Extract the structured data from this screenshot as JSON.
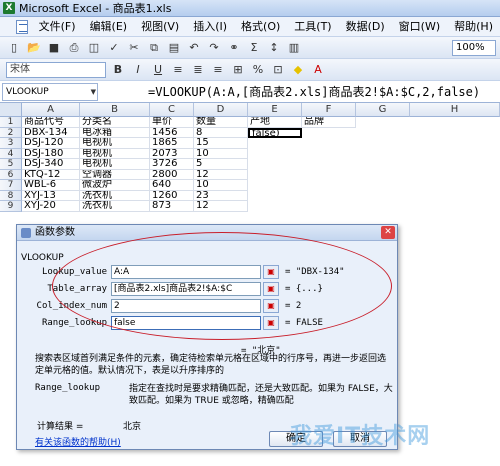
{
  "window": {
    "title": "Microsoft Excel - 商品表1.xls"
  },
  "menu": [
    "文件(F)",
    "编辑(E)",
    "视图(V)",
    "插入(I)",
    "格式(O)",
    "工具(T)",
    "数据(D)",
    "窗口(W)",
    "帮助(H)"
  ],
  "toolbar": {
    "zoom": "100%",
    "font": "宋体"
  },
  "formula_bar": {
    "name_box": "VLOOKUP",
    "formula": "=VLOOKUP(A:A,[商品表2.xls]商品表2!$A:$C,2,false)"
  },
  "columns": [
    "A",
    "B",
    "C",
    "D",
    "E",
    "F",
    "G",
    "H"
  ],
  "rows": [
    [
      "商品代号",
      "分类名",
      "单价",
      "数量",
      "产地",
      "品牌"
    ],
    [
      "DBX-134",
      "电冰箱",
      "1456",
      "8",
      "false)",
      ""
    ],
    [
      "DSJ-120",
      "电视机",
      "1865",
      "15",
      "",
      ""
    ],
    [
      "DSJ-180",
      "电视机",
      "2073",
      "10",
      "",
      ""
    ],
    [
      "DSJ-340",
      "电视机",
      "3726",
      "5",
      "",
      ""
    ],
    [
      "KTQ-12",
      "空调器",
      "2800",
      "12",
      "",
      ""
    ],
    [
      "WBL-6",
      "微波炉",
      "640",
      "10",
      "",
      ""
    ],
    [
      "XYJ-13",
      "洗衣机",
      "1260",
      "23",
      "",
      ""
    ],
    [
      "XYJ-20",
      "洗衣机",
      "873",
      "12",
      "",
      ""
    ]
  ],
  "dialog": {
    "title": "函数参数",
    "function_name": "VLOOKUP",
    "args": [
      {
        "label": "Lookup_value",
        "value": "A:A",
        "result": "= \"DBX-134\""
      },
      {
        "label": "Table_array",
        "value": "[商品表2.xls]商品表2!$A:$C",
        "result": "= {...}"
      },
      {
        "label": "Col_index_num",
        "value": "2",
        "result": "= 2"
      },
      {
        "label": "Range_lookup",
        "value": "false",
        "result": "= FALSE"
      }
    ],
    "formula_result_line": "= \"北京\"",
    "description": "搜索表区域首列满足条件的元素，确定待检索单元格在区域中的行序号，再进一步返回选定单元格的值。默认情况下，表是以升序排序的",
    "arg_help_name": "Range_lookup",
    "arg_help_text": "指定在查找时是要求精确匹配，还是大致匹配。如果为 FALSE，大致匹配。如果为 TRUE 或忽略，精确匹配",
    "calc_label": "计算结果 =",
    "calc_value": "北京",
    "help_link": "有关该函数的帮助(H)",
    "ok": "确定",
    "cancel": "取消"
  },
  "watermark": "我爱IT技术网"
}
